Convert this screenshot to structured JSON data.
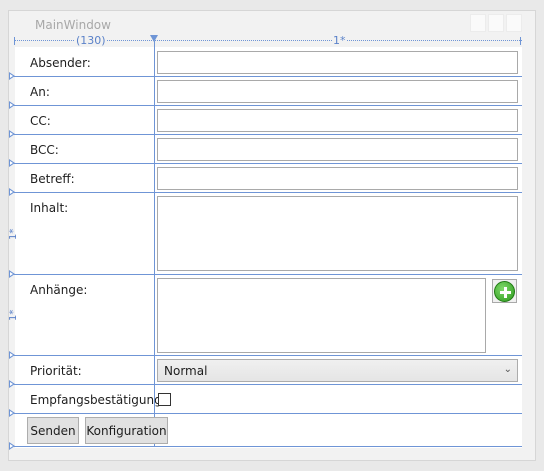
{
  "window": {
    "title": "MainWindow"
  },
  "designer": {
    "col1_width": "(130)",
    "col2_width": "1*",
    "row_star_1": "1*",
    "row_star_2": "1*"
  },
  "form": {
    "labels": {
      "sender": "Absender:",
      "to": "An:",
      "cc": "CC:",
      "bcc": "BCC:",
      "subject": "Betreff:",
      "content": "Inhalt:",
      "attachments": "Anhänge:",
      "priority": "Priorität:",
      "receipt": "Empfangsbestätigung:"
    },
    "values": {
      "sender": "",
      "to": "",
      "cc": "",
      "bcc": "",
      "subject": "",
      "content": ""
    },
    "priority": {
      "selected": "Normal"
    },
    "receipt_checked": false
  },
  "buttons": {
    "send": "Senden",
    "config": "Konfiguration"
  },
  "icons": {
    "add_attachment": "plus-circle-icon",
    "dropdown": "chevron-down-icon"
  },
  "colors": {
    "grid_line": "#6f95d6",
    "add_icon": "#3aa827"
  }
}
